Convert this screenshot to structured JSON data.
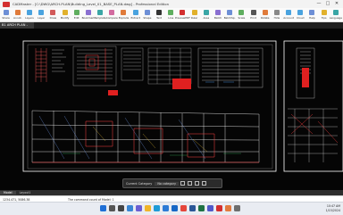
{
  "window": {
    "title": "CADMaster - [C:\\DWG\\ARCH-PLAN\\Building_Level_01_BASE_PLAN.dwg] - Professional Edition",
    "controls": [
      "—",
      "□",
      "✕"
    ]
  },
  "toolbar": {
    "buttons": [
      {
        "label": "Share",
        "icon": "share-icon",
        "color": "#6d8fd6"
      },
      {
        "label": "Annot.",
        "icon": "annotate-icon",
        "color": "#e07b3b"
      },
      {
        "label": "Layers",
        "icon": "layers-icon",
        "color": "#4aa3df"
      },
      {
        "label": "Layer",
        "icon": "layer-icon",
        "color": "#4aa3df"
      },
      {
        "label": "Draw",
        "icon": "draw-icon",
        "color": "#d25a5a"
      },
      {
        "label": "Modify",
        "icon": "modify-icon",
        "color": "#e1b12c"
      },
      {
        "label": "Edit",
        "icon": "edit-icon",
        "color": "#5fae5f"
      },
      {
        "label": "Bookmark",
        "icon": "bookmark-icon",
        "color": "#8a6fd1"
      },
      {
        "label": "Template",
        "icon": "template-icon",
        "color": "#3aa6a6"
      },
      {
        "label": "Compare",
        "icon": "compare-icon",
        "color": "#d26ba0"
      },
      {
        "label": "Explode",
        "icon": "explode-icon",
        "color": "#e07b3b"
      },
      {
        "label": "Extract",
        "icon": "extract-icon",
        "color": "#4aa3df"
      },
      {
        "label": "Shape",
        "icon": "shape-icon",
        "color": "#6d8fd6"
      },
      {
        "label": "Text",
        "icon": "text-icon",
        "color": "#333333"
      },
      {
        "label": "Line",
        "icon": "line-icon",
        "color": "#5fae5f"
      },
      {
        "label": "PreviewPDF",
        "icon": "preview-pdf-icon",
        "color": "#d32f2f"
      },
      {
        "label": "Ruler",
        "icon": "ruler-icon",
        "color": "#e1b12c"
      },
      {
        "label": "Area",
        "icon": "area-icon",
        "color": "#3aa6a6"
      },
      {
        "label": "Batch",
        "icon": "batch-icon",
        "color": "#8a6fd1"
      },
      {
        "label": "BatchSp.",
        "icon": "batch-split-icon",
        "color": "#6d8fd6"
      },
      {
        "label": "Scale",
        "icon": "scale-icon",
        "color": "#5fae5f"
      },
      {
        "label": "Print",
        "icon": "print-icon",
        "color": "#555555"
      },
      {
        "label": "Rotate",
        "icon": "rotate-icon",
        "color": "#e07b3b"
      },
      {
        "label": "Hide",
        "icon": "hide-icon",
        "color": "#888888"
      },
      {
        "label": "Account",
        "icon": "account-icon",
        "color": "#4aa3df"
      },
      {
        "label": "Cloud",
        "icon": "cloud-icon",
        "color": "#4aa3df"
      },
      {
        "label": "Help",
        "icon": "help-icon",
        "color": "#6d8fd6"
      },
      {
        "label": "Tips",
        "icon": "tips-icon",
        "color": "#e1b12c"
      },
      {
        "label": "Language",
        "icon": "language-icon",
        "color": "#3aa6a6"
      }
    ]
  },
  "drawing_tab": {
    "label": "B1 ARCH PLAN - Layout"
  },
  "float_toolbar": {
    "layer_label": "Current Category",
    "category_label": "No category",
    "icons": [
      "zoom-in-icon",
      "pan-icon",
      "zoom-extents-icon",
      "fullscreen-icon"
    ]
  },
  "layout_tabs": [
    "Model",
    "Layout1"
  ],
  "command": {
    "coords": "1234.471, 5086.38",
    "message": "The command count of Model: 1"
  },
  "taskbar": {
    "apps": [
      {
        "name": "start-icon",
        "color": "#1f6fd6"
      },
      {
        "name": "search-icon",
        "color": "#555555"
      },
      {
        "name": "task-view-icon",
        "color": "#444444"
      },
      {
        "name": "widgets-icon",
        "color": "#3a86d4"
      },
      {
        "name": "chat-icon",
        "color": "#6b5fd3"
      },
      {
        "name": "explorer-icon",
        "color": "#f0b429"
      },
      {
        "name": "edge-icon",
        "color": "#1e9bd7"
      },
      {
        "name": "store-icon",
        "color": "#2d7bd6"
      },
      {
        "name": "mail-icon",
        "color": "#1667c5"
      },
      {
        "name": "chrome-icon",
        "color": "#e5463b"
      },
      {
        "name": "word-icon",
        "color": "#2b5797"
      },
      {
        "name": "excel-icon",
        "color": "#1f7244"
      },
      {
        "name": "teams-icon",
        "color": "#5059c9"
      },
      {
        "name": "cad-icon",
        "color": "#d32f2f"
      },
      {
        "name": "photos-icon",
        "color": "#e27a3f"
      },
      {
        "name": "settings-icon",
        "color": "#6e6e6e"
      }
    ],
    "time": "10:47 AM",
    "date": "1/15/2024"
  },
  "colors": {
    "canvas": "#050505",
    "frame": "#ffffff",
    "accent_red": "#e02020"
  }
}
